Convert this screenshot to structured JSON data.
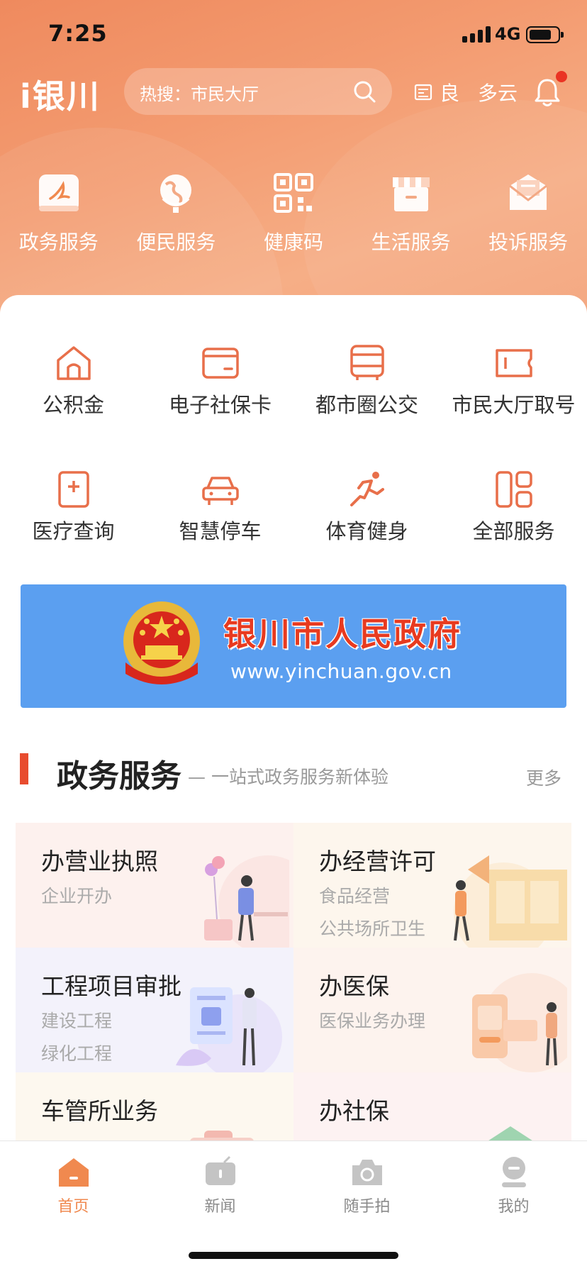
{
  "status_bar": {
    "time": "7:25",
    "network": "4G",
    "battery_level": 0.8
  },
  "header": {
    "app_logo": "i银川",
    "search_placeholder": "热搜：市民大厅",
    "weather": {
      "aqi": "良",
      "condition": "多云"
    },
    "notification_badge": true
  },
  "quick_services": [
    {
      "label": "政务服务",
      "icon": "government-service-icon"
    },
    {
      "label": "便民服务",
      "icon": "globe-icon"
    },
    {
      "label": "健康码",
      "icon": "qr-code-icon"
    },
    {
      "label": "生活服务",
      "icon": "shop-icon"
    },
    {
      "label": "投诉服务",
      "icon": "envelope-icon"
    }
  ],
  "services": [
    {
      "label": "公积金",
      "icon": "house-icon"
    },
    {
      "label": "电子社保卡",
      "icon": "card-icon"
    },
    {
      "label": "都市圈公交",
      "icon": "bus-icon"
    },
    {
      "label": "市民大厅取号",
      "icon": "ticket-icon"
    },
    {
      "label": "医疗查询",
      "icon": "medical-plus-icon"
    },
    {
      "label": "智慧停车",
      "icon": "car-icon"
    },
    {
      "label": "体育健身",
      "icon": "runner-icon"
    },
    {
      "label": "全部服务",
      "icon": "grid-icon"
    }
  ],
  "banner": {
    "title": "银川市人民政府",
    "url": "www.yinchuan.gov.cn"
  },
  "section": {
    "title": "政务服务",
    "subtitle": "— 一站式政务服务新体验",
    "more": "更多"
  },
  "tiles": [
    {
      "title": "办营业执照",
      "lines": [
        "企业开办",
        ""
      ],
      "bg": "#fdf1ee"
    },
    {
      "title": "办经营许可",
      "lines": [
        "食品经营",
        "公共场所卫生"
      ],
      "bg": "#fdf6ed"
    },
    {
      "title": "工程项目审批",
      "lines": [
        "建设工程",
        "绿化工程"
      ],
      "bg": "#f3f2fb"
    },
    {
      "title": "办医保",
      "lines": [
        "医保业务办理",
        ""
      ],
      "bg": "#fdf3ee"
    },
    {
      "title": "车管所业务",
      "lines": [
        "",
        ""
      ],
      "bg": "#fdf8ef"
    },
    {
      "title": "办社保",
      "lines": [
        "",
        ""
      ],
      "bg": "#fdf2f2"
    }
  ],
  "tabbar": [
    {
      "label": "首页",
      "active": true
    },
    {
      "label": "新闻",
      "active": false
    },
    {
      "label": "随手拍",
      "active": false
    },
    {
      "label": "我的",
      "active": false
    }
  ],
  "colors": {
    "accent": "#f0894f",
    "banner_blue": "#5b9ff0",
    "section_red": "#e84c2f",
    "service_icon": "#e86f4a"
  }
}
